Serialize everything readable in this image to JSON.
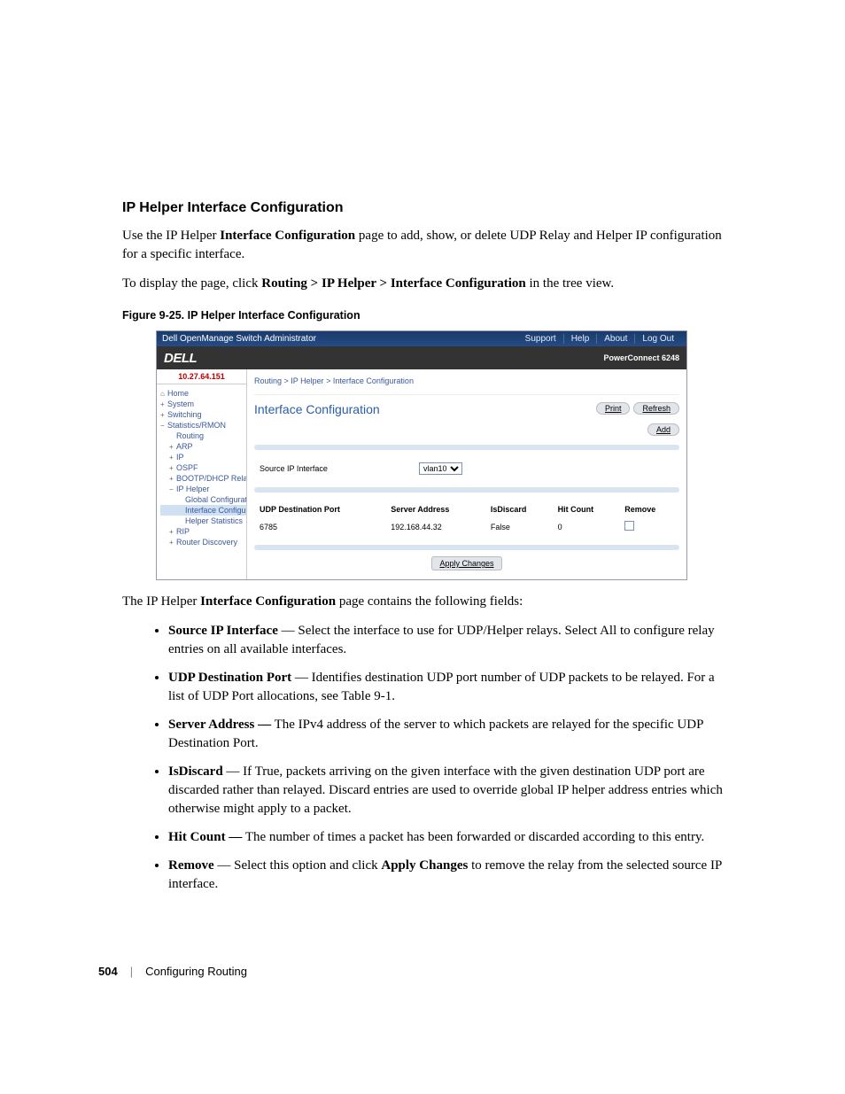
{
  "section_title": "IP Helper Interface Configuration",
  "intro": {
    "line1_pre": "Use the IP Helper ",
    "line1_bold": "Interface Configuration",
    "line1_post": " page to add, show, or delete UDP Relay and Helper IP configuration for a specific interface.",
    "line2_pre": "To display the page, click ",
    "line2_bold": "Routing > IP Helper > Interface Configuration",
    "line2_post": " in the tree view."
  },
  "figure_caption": "Figure 9-25.    IP Helper Interface Configuration",
  "screenshot": {
    "window_title": "Dell OpenManage Switch Administrator",
    "topnav": [
      "Support",
      "Help",
      "About",
      "Log Out"
    ],
    "logo": "DELL",
    "device_model": "PowerConnect 6248",
    "ip_address": "10.27.64.151",
    "nav": [
      {
        "label": "Home",
        "icon": "home"
      },
      {
        "label": "System",
        "exp": "+"
      },
      {
        "label": "Switching",
        "exp": "+"
      },
      {
        "label": "Statistics/RMON",
        "exp": "−"
      },
      {
        "label": "Routing",
        "sub": true
      },
      {
        "label": "ARP",
        "exp": "+",
        "sub": true
      },
      {
        "label": "IP",
        "exp": "+",
        "sub": true
      },
      {
        "label": "OSPF",
        "exp": "+",
        "sub": true
      },
      {
        "label": "BOOTP/DHCP Relay A",
        "exp": "+",
        "sub": true
      },
      {
        "label": "IP Helper",
        "exp": "−",
        "sub": true
      },
      {
        "label": "Global Configuration",
        "sub2": true
      },
      {
        "label": "Interface Configurati",
        "sub2": true,
        "active": true
      },
      {
        "label": "Helper Statistics",
        "sub2": true
      },
      {
        "label": "RIP",
        "exp": "+",
        "sub": true
      },
      {
        "label": "Router Discovery",
        "exp": "+",
        "sub": true
      }
    ],
    "breadcrumb": "Routing > IP Helper > Interface Configuration",
    "main_heading": "Interface Configuration",
    "buttons": {
      "print": "Print",
      "refresh": "Refresh",
      "add": "Add"
    },
    "form": {
      "source_ip_label": "Source IP Interface",
      "source_ip_value": "vlan10"
    },
    "table": {
      "headers": [
        "UDP Destination Port",
        "Server Address",
        "IsDiscard",
        "Hit Count",
        "Remove"
      ],
      "row": {
        "port": "6785",
        "server": "192.168.44.32",
        "discard": "False",
        "hits": "0"
      }
    },
    "apply_label": "Apply Changes"
  },
  "post_figure_intro_pre": "The IP Helper ",
  "post_figure_intro_bold": "Interface Configuration",
  "post_figure_intro_post": " page contains the following fields:",
  "fields": [
    {
      "name": "Source IP Interface",
      "desc": " — Select the interface to use for UDP/Helper relays. Select All to configure relay entries on all available interfaces."
    },
    {
      "name": "UDP Destination Port",
      "desc": " — Identifies destination UDP port number of UDP packets to be relayed. For a list of UDP Port allocations, see Table 9-1."
    },
    {
      "name": "Server Address —",
      "desc": " The IPv4 address of the server to which packets are relayed for the specific UDP Destination Port."
    },
    {
      "name": "IsDiscard",
      "desc": " — If True, packets arriving on the given interface with the given destination UDP port are discarded rather than relayed. Discard entries are used to override global IP helper address entries which otherwise might apply to a packet."
    },
    {
      "name": "Hit Count —",
      "desc": " The number of times a packet has been forwarded or discarded according to this entry."
    },
    {
      "name": "Remove",
      "desc_pre": " — Select this option and click ",
      "desc_bold": "Apply Changes",
      "desc_post": " to remove the relay from the selected source IP interface."
    }
  ],
  "footer": {
    "page": "504",
    "section": "Configuring Routing"
  }
}
